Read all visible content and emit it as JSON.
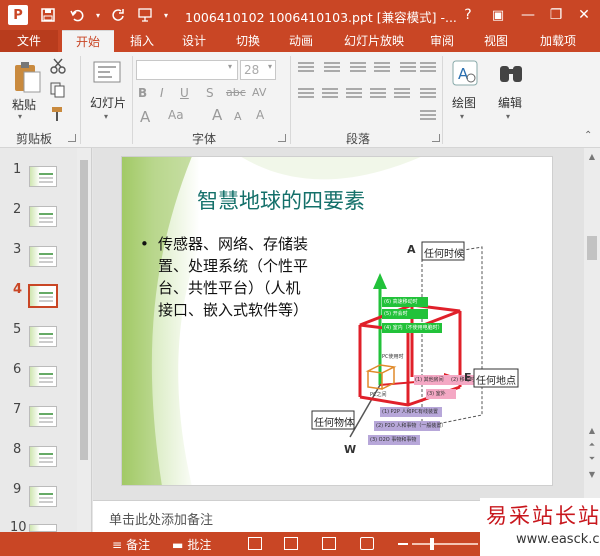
{
  "title_bar": {
    "logo": "P",
    "title": "1006410102 1006410103.ppt [兼容模式] -...",
    "help": "?",
    "minimize": "—",
    "restore": "❐",
    "close": "✕",
    "ribbon_display": "▣"
  },
  "tabs": [
    {
      "label": "文件"
    },
    {
      "label": "开始"
    },
    {
      "label": "插入"
    },
    {
      "label": "设计"
    },
    {
      "label": "切换"
    },
    {
      "label": "动画"
    },
    {
      "label": "幻灯片放映"
    },
    {
      "label": "审阅"
    },
    {
      "label": "视图"
    },
    {
      "label": "加载项"
    }
  ],
  "ribbon": {
    "clipboard": {
      "paste": "粘贴",
      "group": "剪贴板"
    },
    "slides": {
      "new_slide": "幻灯片",
      "group": ""
    },
    "font": {
      "size": "28",
      "group": "字体",
      "bold": "B",
      "italic": "I",
      "underline": "U",
      "shadow": "S",
      "strike": "abc",
      "case": "Aa"
    },
    "paragraph": {
      "group": "段落"
    },
    "drawing": {
      "label": "绘图"
    },
    "editing": {
      "label": "编辑"
    }
  },
  "thumbnails": [
    {
      "num": "1"
    },
    {
      "num": "2"
    },
    {
      "num": "3"
    },
    {
      "num": "4"
    },
    {
      "num": "5"
    },
    {
      "num": "6"
    },
    {
      "num": "7"
    },
    {
      "num": "8"
    },
    {
      "num": "9"
    },
    {
      "num": "10"
    }
  ],
  "selected_slide": 4,
  "slide": {
    "title": "智慧地球的四要素",
    "bullet": "•",
    "body": "传感器、网络、存储装置、处理系统（个性平台、共性平台）（人机接口、嵌入式软件等）",
    "diagram": {
      "axis_a": "A",
      "label_a": "任何时候",
      "axis_e": "E",
      "label_e": "任何地点",
      "axis_w": "W",
      "label_w": "任何物体",
      "green_rows": [
        "(6) 高速移动时",
        "(5) 开会时",
        "(4) 室内（不使用电脑时）"
      ],
      "pc_label": "PC使用时",
      "pc_front": "PC之间",
      "pink_rows": [
        "(1) 其他房间",
        "(2) 移动时",
        "(3) 室外"
      ],
      "violet_rows": [
        "(1) P2P 人和PC有线装置",
        "(2) P2O 人和事物（一般装置）",
        "(3) O2O 事物和事物"
      ]
    }
  },
  "notes": {
    "placeholder": "单击此处添加备注"
  },
  "status": {
    "notes": "备注",
    "comments": "批注"
  },
  "watermark": {
    "text": "易采站长站",
    "url": "www.easck.com"
  },
  "colors": {
    "accent": "#c94625",
    "slide_title": "#14706a",
    "axis_red": "#e0202a",
    "axis_green": "#22c23a",
    "pink": "#f4a8c4",
    "violet": "#b7a7d9"
  }
}
